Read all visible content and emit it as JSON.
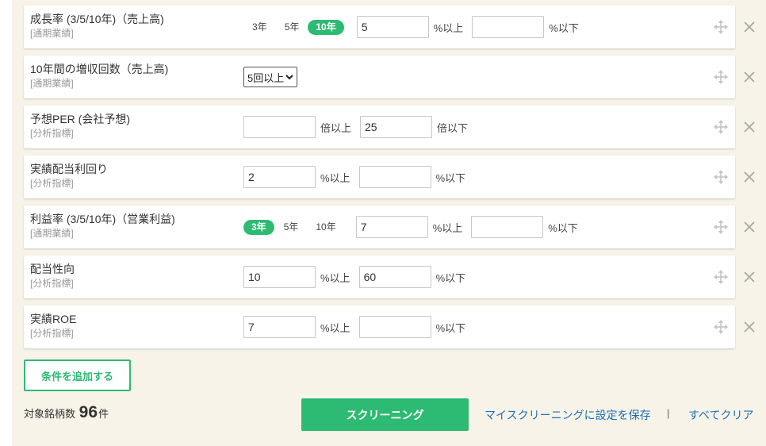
{
  "conditions": [
    {
      "title": "成長率 (3/5/10年)（売上高)",
      "category": "[通期業績]",
      "periods": [
        "3年",
        "5年",
        "10年"
      ],
      "active_period": "10年",
      "min_value": "5",
      "min_unit": "%以上",
      "max_value": "",
      "max_unit": "%以下"
    },
    {
      "title": "10年間の増収回数（売上高)",
      "category": "[通期業績]",
      "select_value": "5回以上"
    },
    {
      "title": "予想PER (会社予想)",
      "category": "[分析指標]",
      "min_value": "",
      "min_unit": "倍以上",
      "max_value": "25",
      "max_unit": "倍以下"
    },
    {
      "title": "実績配当利回り",
      "category": "[分析指標]",
      "min_value": "2",
      "min_unit": "%以上",
      "max_value": "",
      "max_unit": "%以下"
    },
    {
      "title": "利益率 (3/5/10年)（営業利益)",
      "category": "[通期業績]",
      "periods": [
        "3年",
        "5年",
        "10年"
      ],
      "active_period": "3年",
      "min_value": "7",
      "min_unit": "%以上",
      "max_value": "",
      "max_unit": "%以下"
    },
    {
      "title": "配当性向",
      "category": "[分析指標]",
      "min_value": "10",
      "min_unit": "%以上",
      "max_value": "60",
      "max_unit": "%以下"
    },
    {
      "title": "実績ROE",
      "category": "[分析指標]",
      "min_value": "7",
      "min_unit": "%以上",
      "max_value": "",
      "max_unit": "%以下"
    }
  ],
  "actions": {
    "add_condition_label": "条件を追加する",
    "count_prefix": "対象銘柄数",
    "count_value": "96",
    "count_suffix": "件",
    "screening_label": "スクリーニング",
    "save_link": "マイスクリーニングに設定を保存",
    "separator": "|",
    "clear_link": "すべてクリア"
  },
  "colors": {
    "accent": "#2dba73",
    "panel_bg": "#f7f3e8",
    "link": "#1f6fb5"
  },
  "icons": {
    "row_drag": "move-icon",
    "row_remove": "close-icon",
    "select_arrow": "chevron-down-icon"
  }
}
